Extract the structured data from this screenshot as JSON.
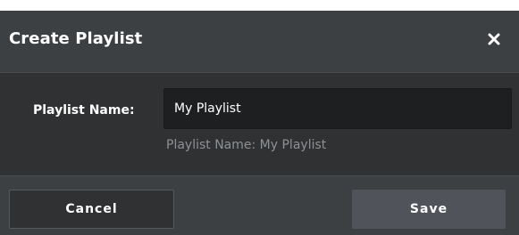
{
  "dialog": {
    "title": "Create Playlist",
    "close_icon": "close-icon"
  },
  "form": {
    "playlist_name_label": "Playlist Name:",
    "playlist_name_value": "My Playlist",
    "playlist_name_hint": "Playlist Name: My Playlist"
  },
  "footer": {
    "cancel_label": "Cancel",
    "save_label": "Save"
  },
  "colors": {
    "header_bg": "#3d4043",
    "body_bg": "#2f3133",
    "input_bg": "#1e1f20",
    "save_bg": "#50545a",
    "hint_text": "#8e9194"
  }
}
